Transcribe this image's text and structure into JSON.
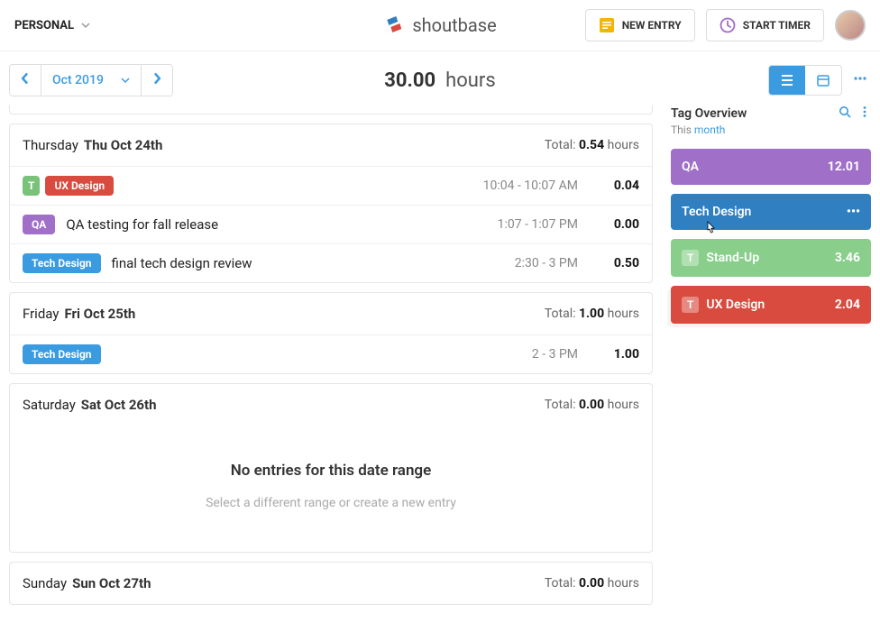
{
  "header": {
    "workspace": "PERSONAL",
    "brand": "shoutbase",
    "new_entry": "NEW ENTRY",
    "start_timer": "START TIMER"
  },
  "toolbar": {
    "period_label": "Oct 2019",
    "total_hours_value": "30.00",
    "total_hours_word": "hours"
  },
  "days": [
    {
      "name": "Thursday",
      "date": "Thu Oct 24th",
      "total_prefix": "Total: ",
      "total_value": "0.54",
      "total_suffix": " hours",
      "entries": [
        {
          "tags": [
            {
              "t": "T",
              "cls": "green small"
            },
            {
              "t": "UX Design",
              "cls": "red"
            }
          ],
          "desc": "",
          "time": "10:04 - 10:07 AM",
          "dur": "0.04"
        },
        {
          "tags": [
            {
              "t": "QA",
              "cls": "purple"
            }
          ],
          "desc": "QA testing for fall release",
          "time": "1:07 - 1:07 PM",
          "dur": "0.00"
        },
        {
          "tags": [
            {
              "t": "Tech Design",
              "cls": "blue"
            }
          ],
          "desc": "final tech design review",
          "time": "2:30 - 3 PM",
          "dur": "0.50"
        }
      ]
    },
    {
      "name": "Friday",
      "date": "Fri Oct 25th",
      "total_prefix": "Total: ",
      "total_value": "1.00",
      "total_suffix": " hours",
      "entries": [
        {
          "tags": [
            {
              "t": "Tech Design",
              "cls": "blue"
            }
          ],
          "desc": "",
          "time": "2 - 3 PM",
          "dur": "1.00"
        }
      ]
    },
    {
      "name": "Saturday",
      "date": "Sat Oct 26th",
      "total_prefix": "Total: ",
      "total_value": "0.00",
      "total_suffix": " hours",
      "empty": true
    },
    {
      "name": "Sunday",
      "date": "Sun Oct 27th",
      "total_prefix": "Total: ",
      "total_value": "0.00",
      "total_suffix": " hours"
    }
  ],
  "empty_state": {
    "heading": "No entries for this date range",
    "sub": "Select a different range or create a new entry"
  },
  "panel": {
    "title": "Tag Overview",
    "sub_prefix": "This ",
    "sub_link": "month",
    "items": [
      {
        "name": "QA",
        "val": "12.01",
        "cls": "purple",
        "prefix": ""
      },
      {
        "name": "Tech Design",
        "val": "•••",
        "cls": "blue",
        "prefix": "",
        "hovered": true
      },
      {
        "name": "Stand-Up",
        "val": "3.46",
        "cls": "green",
        "prefix": "T"
      },
      {
        "name": "UX Design",
        "val": "2.04",
        "cls": "red offset",
        "prefix": "T"
      }
    ]
  },
  "colors": {
    "blue": "#3b9be0",
    "darkblue": "#2f7fc1",
    "purple": "#a06fc7",
    "green": "#78c27a",
    "red": "#d94a3f"
  }
}
